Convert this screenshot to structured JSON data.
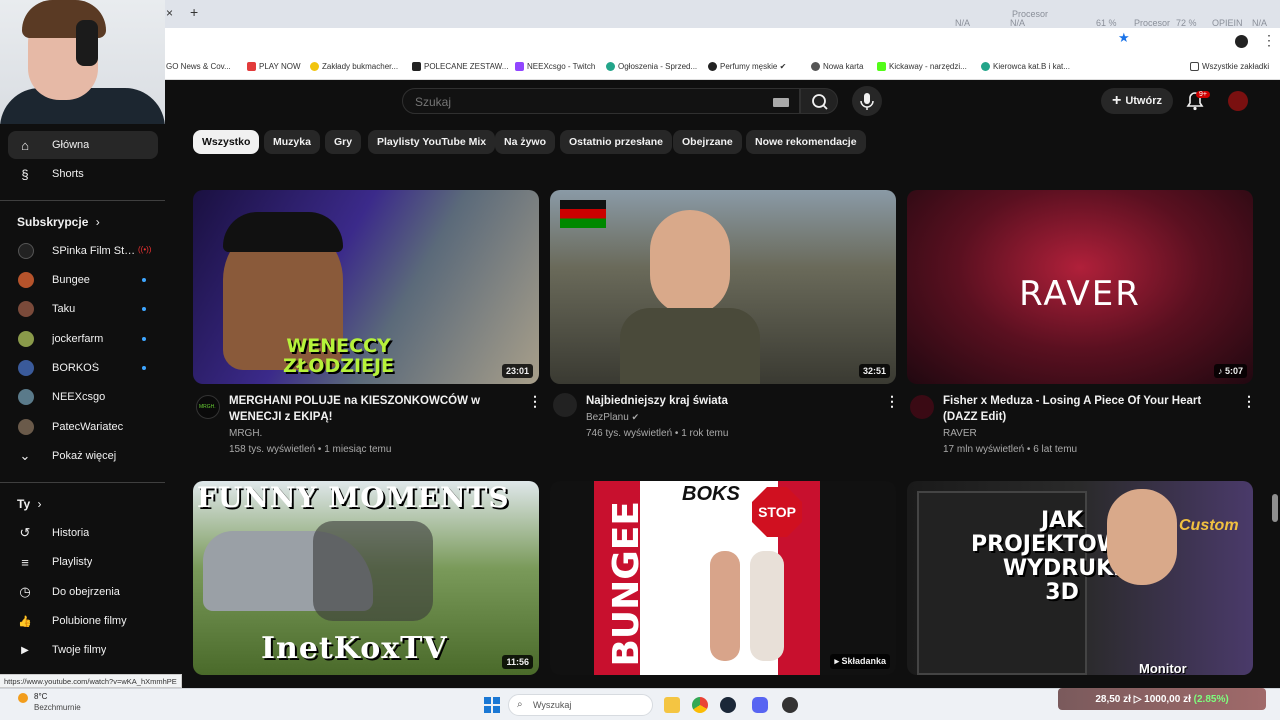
{
  "browser": {
    "tab_close": "×",
    "tab_new": "+",
    "hw_labels": [
      "Procesor",
      "N/A",
      "N/A",
      "61 %",
      "Procesor",
      "72 %",
      "OPIEIN",
      "N/A"
    ],
    "bookmarks": [
      {
        "label": "GO News & Cov...",
        "color": "#5b7bd6"
      },
      {
        "label": "PLAY NOW",
        "color": "#e23b3b"
      },
      {
        "label": "Zakłady bukmacher...",
        "color": "#f1c40f"
      },
      {
        "label": "POLECANE ZESTAW...",
        "color": "#222222"
      },
      {
        "label": "NEEXcsgo - Twitch",
        "color": "#9146ff"
      },
      {
        "label": "Ogłoszenia - Sprzed...",
        "color": "#23a58a"
      },
      {
        "label": "Perfumy męskie ✔",
        "color": "#222222"
      },
      {
        "label": "Nowa karta",
        "color": "#555555"
      },
      {
        "label": "Kickaway - narzędzi...",
        "color": "#53fc18"
      },
      {
        "label": "Kierowca kat.B i kat...",
        "color": "#23a58a"
      }
    ],
    "all_bookmarks": "Wszystkie zakładki",
    "status_url": "https://www.youtube.com/watch?v=wKA_hXmmhPE"
  },
  "header": {
    "search_placeholder": "Szukaj",
    "create_label": "Utwórz",
    "notif_count": "9+"
  },
  "sidebar": {
    "top": [
      {
        "label": "Główna",
        "icon": "home-icon",
        "glyph": "⌂"
      },
      {
        "label": "Shorts",
        "icon": "shorts-icon",
        "glyph": "§"
      }
    ],
    "subs_header": "Subskrypcje",
    "subs_chevron": "›",
    "subs": [
      {
        "label": "SPinka Film Stud...",
        "color": "#222",
        "live": true
      },
      {
        "label": "Bungee",
        "color": "#b5532b",
        "live": true
      },
      {
        "label": "Taku",
        "color": "#7a4a3a",
        "live": true
      },
      {
        "label": "jockerfarm",
        "color": "#8a9a4a",
        "live": true
      },
      {
        "label": "BORKOŚ",
        "color": "#3a5a9a",
        "live": true
      },
      {
        "label": "NEEXcsgo",
        "color": "#5a7a8a",
        "live": false
      },
      {
        "label": "PatecWariatec",
        "color": "#6a5a4a",
        "live": false
      }
    ],
    "show_more": "Pokaż więcej",
    "show_more_glyph": "⌄",
    "you_header": "Ty",
    "you": [
      {
        "label": "Historia",
        "icon": "history-icon",
        "glyph": "↺"
      },
      {
        "label": "Playlisty",
        "icon": "playlists-icon",
        "glyph": "≡"
      },
      {
        "label": "Do obejrzenia",
        "icon": "watch-later-icon",
        "glyph": "◷"
      },
      {
        "label": "Polubione filmy",
        "icon": "like-icon",
        "glyph": "👍"
      },
      {
        "label": "Twoje filmy",
        "icon": "your-videos-icon",
        "glyph": "▶"
      }
    ]
  },
  "chips": [
    "Wszystko",
    "Muzyka",
    "Gry",
    "Playlisty YouTube Mix",
    "Na żywo",
    "Ostatnio przesłane",
    "Obejrzane",
    "Nowe rekomendacje"
  ],
  "videos": [
    {
      "title": "MERGHANI POLUJE na KIESZONKOWCÓW w WENECJI z EKIPĄ!",
      "channel": "MRGH.",
      "meta": "158 tys. wyświetleń • 1 miesiąc temu",
      "duration": "23:01",
      "overlay": "WENECCY\nZŁODZIEJE"
    },
    {
      "title": "Najbiedniejszy kraj świata",
      "channel": "BezPlanu",
      "meta": "746 tys. wyświetleń • 1 rok temu",
      "duration": "32:51",
      "overlay": ""
    },
    {
      "title": "Fisher x Meduza - Losing A Piece Of Your Heart (DAZZ Edit)",
      "channel": "RAVER",
      "meta": "17 mln wyświetleń • 6 lat temu",
      "duration": "♪ 5:07",
      "overlay": "RAVER"
    },
    {
      "title": "",
      "channel": "",
      "meta": "",
      "duration": "11:56",
      "overlay_top": "FUNNY MOMENTS",
      "overlay_bottom": "InetKoxTV"
    },
    {
      "title": "",
      "channel": "",
      "meta": "",
      "duration": "▸ Składanka",
      "overlay_left": "BUNGEE",
      "overlay_top": "BOKS",
      "overlay_sign": "STOP"
    },
    {
      "title": "",
      "channel": "",
      "meta": "",
      "duration": "",
      "overlay": "JAK\nPROJEKTOWAĆ\nWYDRUKI\n3D",
      "overlay_extra": "Monitor",
      "overlay_brand": "Custom"
    }
  ],
  "taskbar": {
    "weather_temp": "8°C",
    "weather_desc": "Bezchmurnie",
    "search_label": "Wyszukaj",
    "stock_text": "28,50 zł  ▷ 1000,00 zł",
    "stock_pct": "(2.85%)"
  }
}
